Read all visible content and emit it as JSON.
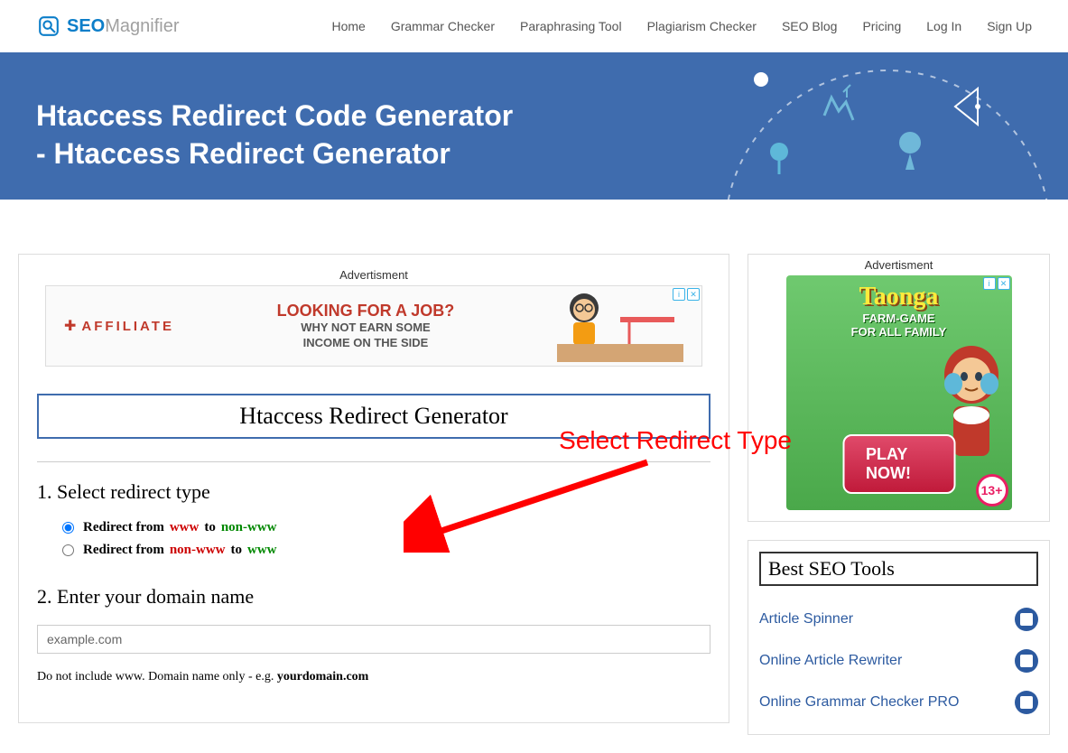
{
  "header": {
    "logo_seo": "SEO",
    "logo_mag": "Magnifier",
    "nav": [
      "Home",
      "Grammar Checker",
      "Paraphrasing Tool",
      "Plagiarism Checker",
      "SEO Blog",
      "Pricing",
      "Log In",
      "Sign Up"
    ]
  },
  "hero": {
    "title_line1": "Htaccess Redirect Code Generator",
    "title_line2": "- Htaccess Redirect Generator"
  },
  "main": {
    "ad_label": "Advertisment",
    "banner": {
      "affiliate": "AFFILIATE",
      "headline": "LOOKING FOR A JOB?",
      "sub1": "WHY NOT EARN SOME",
      "sub2": "INCOME ON THE SIDE"
    },
    "tool_title": "Htaccess Redirect Generator",
    "annotation": "Select Redirect Type",
    "step1": "1. Select redirect type",
    "radio1": {
      "prefix": "Redirect from ",
      "from": "www",
      "mid": " to ",
      "to": "non-www"
    },
    "radio2": {
      "prefix": "Redirect from ",
      "from": "non-www",
      "mid": " to ",
      "to": "www"
    },
    "step2": "2. Enter your domain name",
    "domain_value": "example.com",
    "hint_pre": "Do not include www. Domain name only - e.g. ",
    "hint_bold": "yourdomain.com"
  },
  "sidebar": {
    "ad_label": "Advertisment",
    "taonga": {
      "title": "Taonga",
      "sub1": "FARM-GAME",
      "sub2": "FOR ALL FAMILY",
      "play": "PLAY NOW!",
      "badge": "13+"
    },
    "tools_title": "Best SEO Tools",
    "tools": [
      "Article Spinner",
      "Online Article Rewriter",
      "Online Grammar Checker PRO"
    ]
  }
}
